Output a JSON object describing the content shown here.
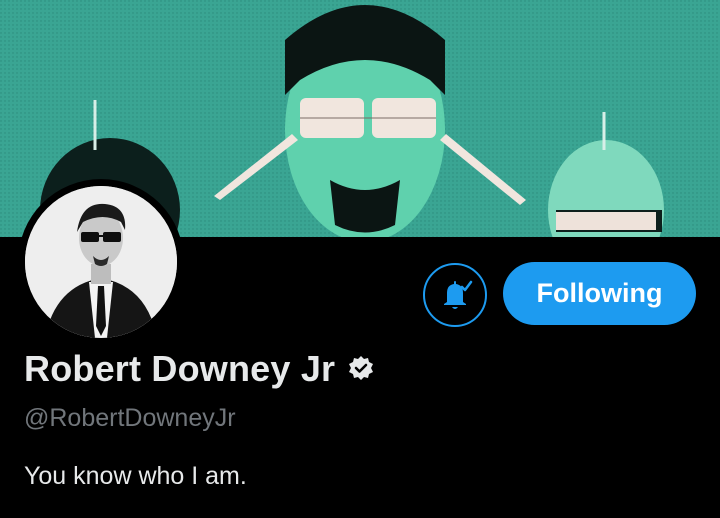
{
  "profile": {
    "display_name": "Robert Downey Jr",
    "handle": "@RobertDowneyJr",
    "bio": "You know who I am.",
    "verified": true
  },
  "actions": {
    "notify_icon": "bell-check-icon",
    "following_label": "Following"
  },
  "colors": {
    "accent": "#1d9bf0",
    "banner": "#3aa593",
    "background": "#000000",
    "name_text": "#e7e9ea",
    "handle_text": "#71767b"
  },
  "icons": {
    "verified": "verified-badge-icon",
    "avatar": "profile-avatar",
    "banner": "profile-banner"
  }
}
